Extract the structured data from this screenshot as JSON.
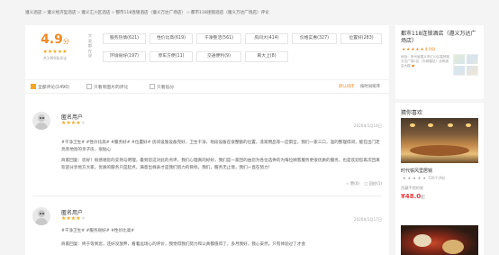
{
  "breadcrumb": [
    "遵义酒店",
    "遵义经济型酒店",
    "遵义汇川区酒店",
    "都市118连锁酒店（遵义万达广场店）",
    "都市118连锁酒店（遵义万达广场店）评论"
  ],
  "breadcrumb_sep": ">",
  "summary": {
    "score": "4.9",
    "score_unit": "分",
    "rating_value": 4.9,
    "rating_max": 5,
    "review_count": "共1490条评论"
  },
  "tags_side_label": "大家都在说",
  "tags": [
    "服务热情(621)",
    "性价比高(619)",
    "干净整洁(561)",
    "房间大(414)",
    "价格实惠(327)",
    "位置好(283)",
    "环境很好(197)",
    "停车方便(11)",
    "交通便利(9)",
    "离大上(8)"
  ],
  "filter": {
    "all": "全部评论(1490)",
    "with_images": "只看有图片的评论",
    "low_score": "只看低分",
    "sort_default": "默认排序",
    "sort_time": "按时间排序"
  },
  "reviews": [
    {
      "user": "匿名用户",
      "stars": 4,
      "date": "2020年5月14日",
      "tags": "#干净卫生# #性价比高# #服务好# #位置好# 房间设施设备完好，卫生干净，地段设备在很整额的位置，洗漱用品等一应俱全，我们一家三口，温的整理得间，能在出门走亮旁地亮的亲子房，很贴心",
      "reply": "商家回复：您好！很感谢您的支持与明理，最到您这对此的点评，我们心理真的好好，我们是一家回的由您为各位选供的为每位顾客服务更很优质的服务，也是欢迎您再次回来欢迎分享地方大家，优质的服务只是起点，满意出样表才是我们努力的目标，我们，服务无止境，我们一直在努力！",
      "like": "赞(0)",
      "reply_btn": "回应(1)"
    },
    {
      "user": "匿名用户",
      "stars": 4,
      "date": "2020年5月17日",
      "tags": "#干净卫生# #服务很好# #性价比高#",
      "reply": "商家回复：终于等到您，还好没放弃，看着远场心的评价，我觉得我们努力和认真都值得了，多月我好，我心安然。只有体验过了才会"
    }
  ],
  "hotel": {
    "name": "都市118连锁酒店（遵义万达广场店）",
    "rating_value": 4.9,
    "rating_max": 5,
    "rating_text": "4.9分",
    "address_label": "地址：",
    "address": "贵州省遵义市汇川区高桥路万达广场C区（天嵊幢站）北侧酒店大楼"
  },
  "recommend": {
    "title": "猜你喜欢",
    "item_name": "时代铁风里居锅",
    "rating_value": 5,
    "rating_max": 5,
    "reviews": "720个评价",
    "sub": "西藏不错的呢",
    "price": "¥48.0",
    "price_unit": "起"
  }
}
